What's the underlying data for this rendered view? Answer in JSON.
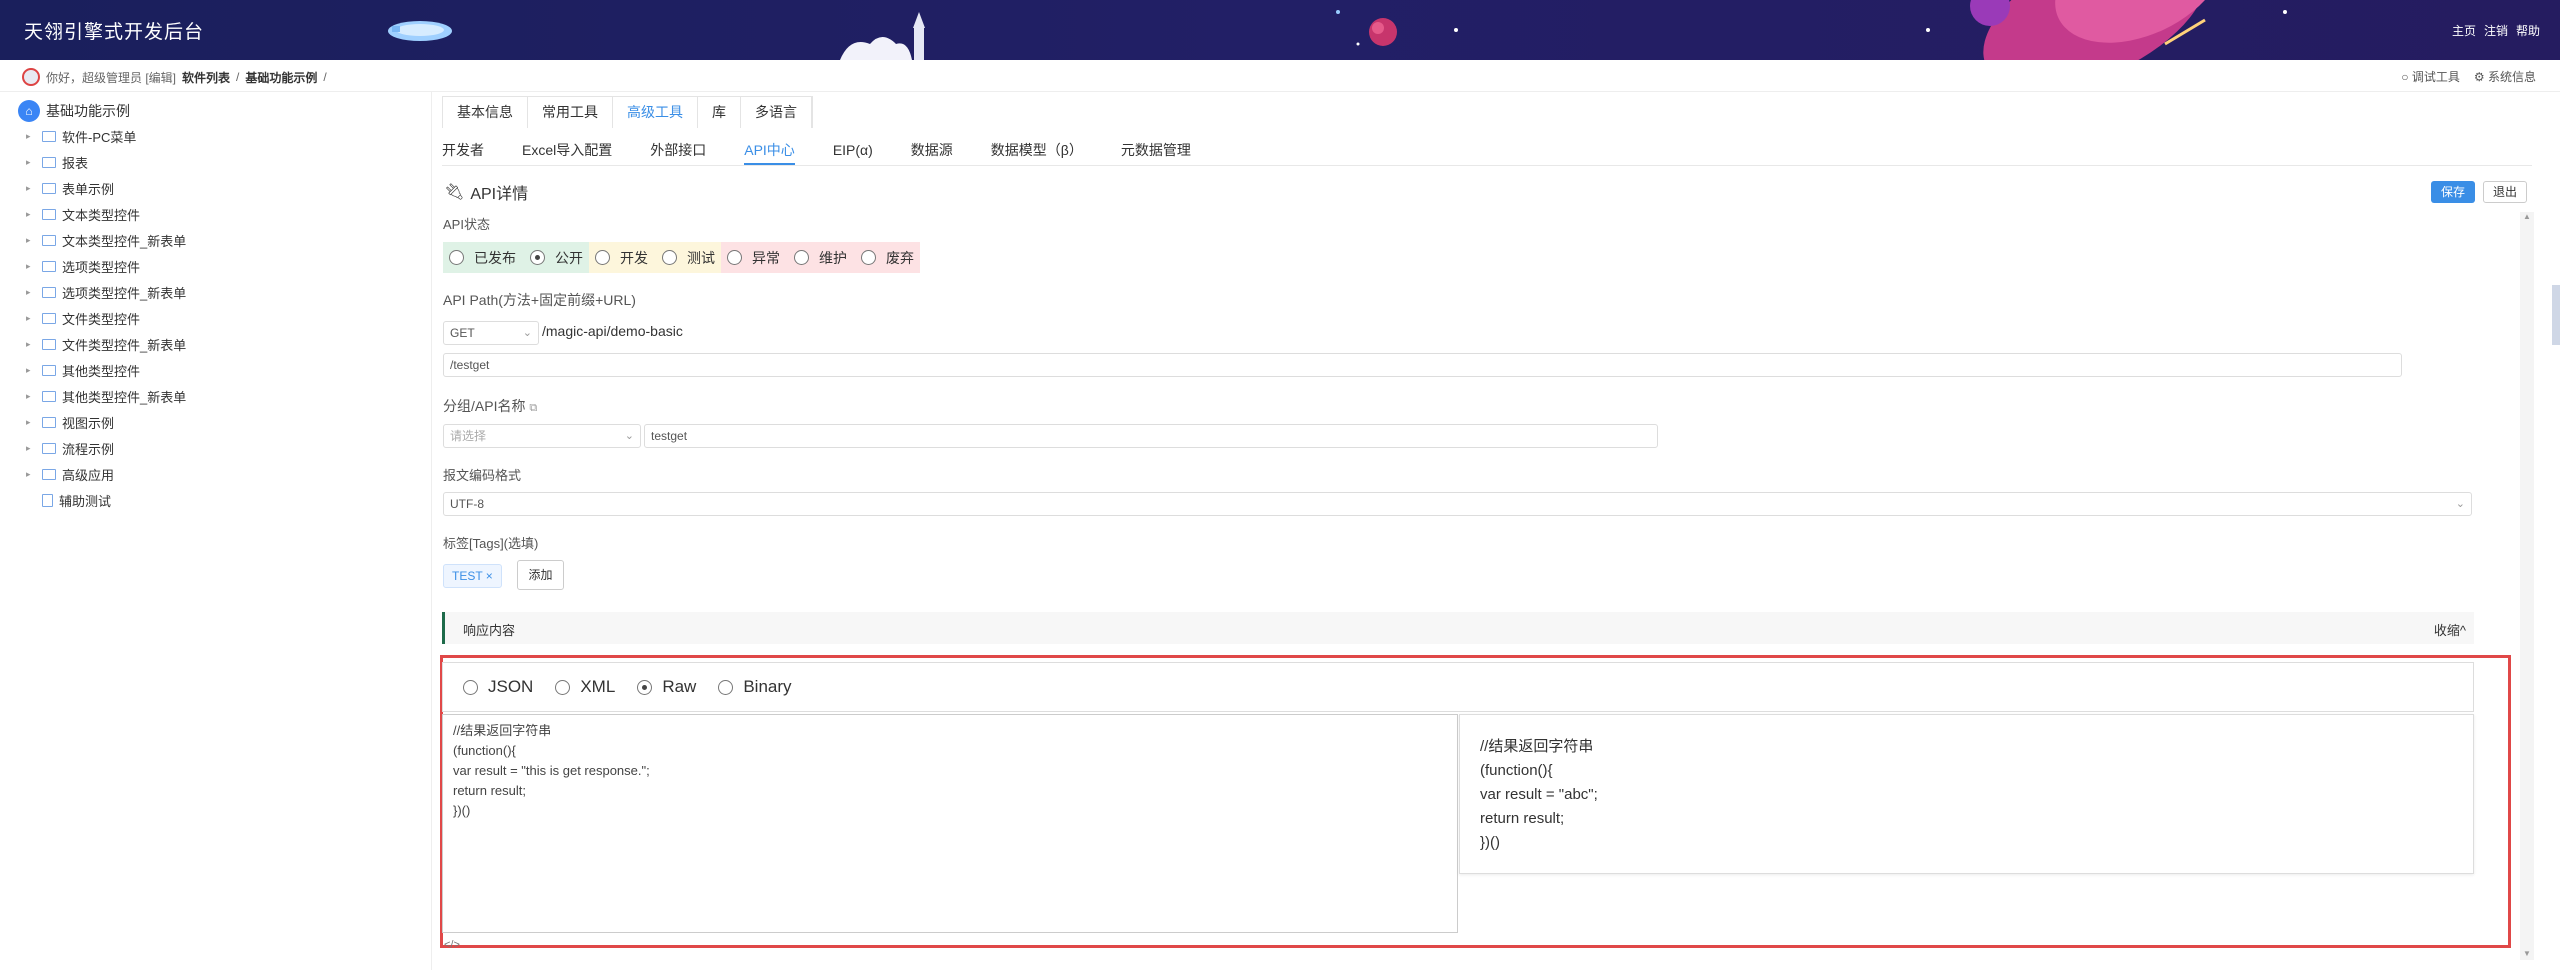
{
  "app": {
    "title": "天翎引擎式开发后台"
  },
  "topnav": {
    "home": "主页",
    "logout": "注销",
    "help": "帮助"
  },
  "breadcrumb": {
    "greeting": "你好，超级管理员 [编辑]",
    "item1": "软件列表",
    "sep1": "/",
    "item2": "基础功能示例",
    "sep2": "/"
  },
  "toolbar": {
    "debug": "调试工具",
    "sysinfo": "系统信息"
  },
  "sidebar": {
    "root": "基础功能示例",
    "items": [
      {
        "label": "软件-PC菜单"
      },
      {
        "label": "报表"
      },
      {
        "label": "表单示例"
      },
      {
        "label": "文本类型控件"
      },
      {
        "label": "文本类型控件_新表单"
      },
      {
        "label": "选项类型控件"
      },
      {
        "label": "选项类型控件_新表单"
      },
      {
        "label": "文件类型控件"
      },
      {
        "label": "文件类型控件_新表单"
      },
      {
        "label": "其他类型控件"
      },
      {
        "label": "其他类型控件_新表单"
      },
      {
        "label": "视图示例"
      },
      {
        "label": "流程示例"
      },
      {
        "label": "高级应用"
      },
      {
        "label": "辅助测试"
      }
    ]
  },
  "tabs1": [
    "基本信息",
    "常用工具",
    "高级工具",
    "库",
    "多语言"
  ],
  "tabs2": [
    "开发者",
    "Excel导入配置",
    "外部接口",
    "API中心",
    "EIP(α)",
    "数据源",
    "数据模型（β）",
    "元数据管理"
  ],
  "panel": {
    "title": "API详情",
    "save": "保存",
    "exit": "退出"
  },
  "form": {
    "status_label": "API状态",
    "statuses": [
      "已发布",
      "公开",
      "开发",
      "测试",
      "异常",
      "维护",
      "废弃"
    ],
    "path_label": "API Path(方法+固定前缀+URL)",
    "method": "GET",
    "prefix": "/magic-api/demo-basic",
    "path_value": "/testget",
    "group_label": "分组/API名称",
    "group_placeholder": "请选择",
    "api_name": "testget",
    "encoding_label": "报文编码格式",
    "encoding": "UTF-8",
    "tags_label": "标签[Tags](选填)",
    "tag": "TEST ×",
    "add": "添加"
  },
  "response": {
    "title": "响应内容",
    "collapse": "收缩^",
    "formats": [
      "JSON",
      "XML",
      "Raw",
      "Binary"
    ],
    "selected_format": "Raw",
    "editor_code": "//结果返回字符串\n(function(){\nvar result = \"this is get response.\";\nreturn result;\n})()",
    "preview_code": "//结果返回字符串\n(function(){\nvar result = \"abc\";\nreturn result;\n})()",
    "code_icon": "</>"
  },
  "colors": {
    "header": "#1d1e5e",
    "accent": "#3a8ee6",
    "highlight": "#e04848"
  }
}
